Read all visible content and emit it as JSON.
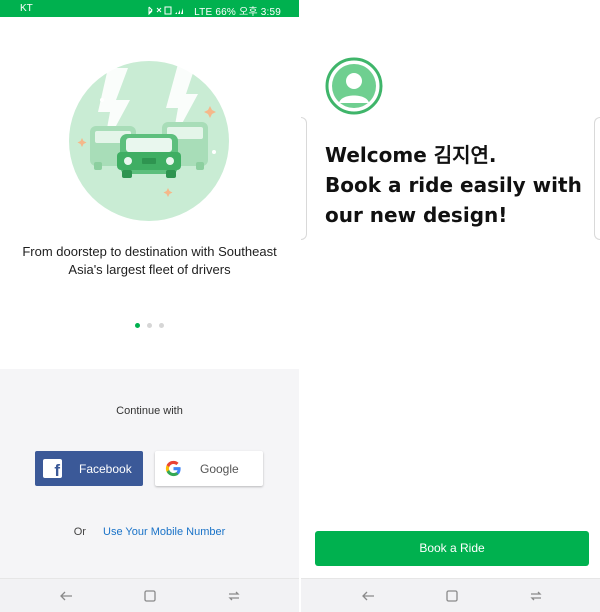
{
  "status_bar": {
    "carrier": "KT",
    "indicators": "LTE",
    "battery": "66%",
    "time": "오후 3:59",
    "icons": [
      "bluetooth-icon",
      "mute-icon",
      "nfc-icon",
      "signal-icon"
    ]
  },
  "onboarding": {
    "illustration": "cars-traffic-illustration",
    "tagline": "From doorstep to destination with Southeast Asia's largest fleet of drivers",
    "carousel": {
      "count": 3,
      "active_index": 0
    }
  },
  "login": {
    "continue_with": "Continue with",
    "facebook_label": "Facebook",
    "google_label": "Google",
    "or_label": "Or",
    "mobile_link": "Use Your Mobile Number"
  },
  "welcome_screen": {
    "avatar_icon": "user-avatar-icon",
    "line1": "Welcome 김지연.",
    "line2": "Book a ride easily with",
    "line3": "our new design!",
    "book_button": "Book a Ride"
  },
  "nav_bar": {
    "icons": [
      "back-icon",
      "home-icon",
      "recents-icon"
    ]
  },
  "colors": {
    "brand_green": "#00b14f",
    "facebook_blue": "#3b5998",
    "link_blue": "#1a73c8"
  }
}
